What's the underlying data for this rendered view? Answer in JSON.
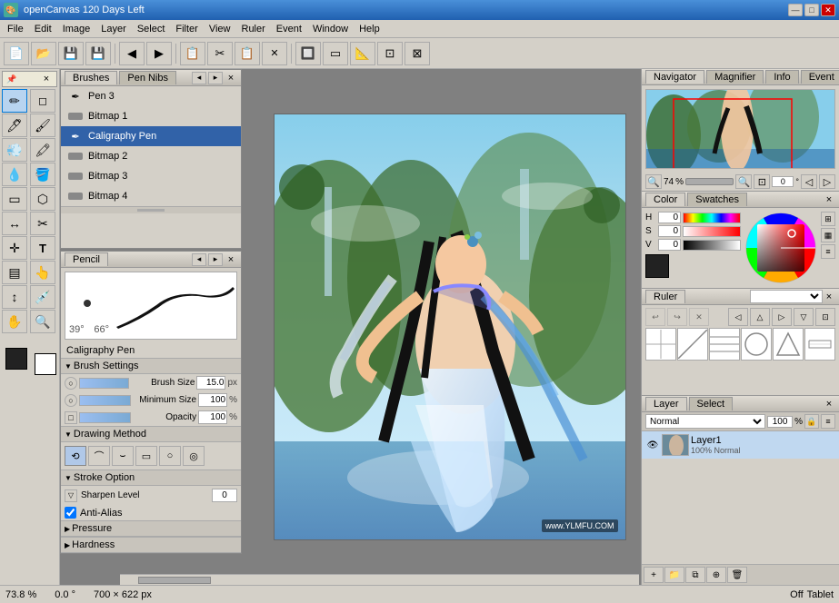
{
  "app": {
    "title": "openCanvas 120 Days Left",
    "icon": "🎨"
  },
  "title_buttons": {
    "minimize": "—",
    "maximize": "□",
    "close": "✕"
  },
  "menu": {
    "items": [
      "File",
      "Edit",
      "Image",
      "Layer",
      "Select",
      "Filter",
      "View",
      "Ruler",
      "Event",
      "Window",
      "Help"
    ]
  },
  "toolbar": {
    "buttons": [
      "📄",
      "📂",
      "💾",
      "💾",
      "◀",
      "▶",
      "📋",
      "✂",
      "📋",
      "🗑",
      "🔲",
      "🔲",
      "📐",
      "🔲"
    ]
  },
  "toolbox": {
    "title": "×",
    "tools": [
      "✏",
      "🔍",
      "✏",
      "🖊",
      "🖌",
      "🖍",
      "🖊",
      "🖌",
      "💧",
      "🪣",
      "🔲",
      "⬡",
      "✂",
      "✏",
      "🔲",
      "✏",
      "↕",
      "🔡",
      "✋",
      "🔍"
    ]
  },
  "brushes_panel": {
    "tabs": [
      "Brushes",
      "Pen Nibs"
    ],
    "items": [
      {
        "name": "Pen 3",
        "icon": "✒"
      },
      {
        "name": "Bitmap 1",
        "icon": "🖼"
      },
      {
        "name": "Caligraphy Pen",
        "icon": "✒",
        "active": true
      },
      {
        "name": "Bitmap 2",
        "icon": "🖼"
      },
      {
        "name": "Bitmap 3",
        "icon": "🖼"
      },
      {
        "name": "Bitmap 4",
        "icon": "🖼"
      }
    ],
    "close": "×",
    "scroll": "▼"
  },
  "pencil_panel": {
    "title": "Pencil",
    "close": "×",
    "angle": "39°",
    "size_angle": "66°",
    "brush_name": "Caligraphy Pen",
    "brush_settings_label": "Brush Settings",
    "brush_size_label": "Brush Size",
    "brush_size_value": "15.0",
    "brush_size_unit": "px",
    "min_size_label": "Minimum Size",
    "min_size_value": "100",
    "min_size_unit": "%",
    "opacity_label": "Opacity",
    "opacity_value": "100",
    "opacity_unit": "%",
    "drawing_method_label": "Drawing Method",
    "stroke_option_label": "Stroke Option",
    "sharpen_label": "Sharpen Level",
    "sharpen_value": "0",
    "anti_alias_label": "Anti-Alias",
    "pressure_label": "Pressure",
    "hardness_label": "Hardness"
  },
  "navigator_panel": {
    "tabs": [
      "Navigator",
      "Magnifier",
      "Info",
      "Event"
    ],
    "zoom_value": "74",
    "zoom_percent": "%",
    "angle_value": "0",
    "close": "×"
  },
  "color_panel": {
    "tabs": [
      "Color",
      "Swatches"
    ],
    "h_label": "H",
    "s_label": "S",
    "v_label": "V",
    "h_value": "0",
    "s_value": "0",
    "v_value": "0",
    "close": "×"
  },
  "ruler_panel": {
    "title": "Ruler",
    "close": "×",
    "dropdown_value": ""
  },
  "layer_panel": {
    "tabs": [
      "Layer",
      "Select"
    ],
    "close": "×",
    "blend_mode": "Normal",
    "opacity_value": "100",
    "opacity_percent": "%",
    "layer_name": "Layer1",
    "layer_info": "100% Normal"
  },
  "status_bar": {
    "zoom": "73.8 %",
    "angle": "0.0 °",
    "size": "700 × 622 px",
    "tablet": "Off",
    "tablet_label": "Tablet"
  }
}
